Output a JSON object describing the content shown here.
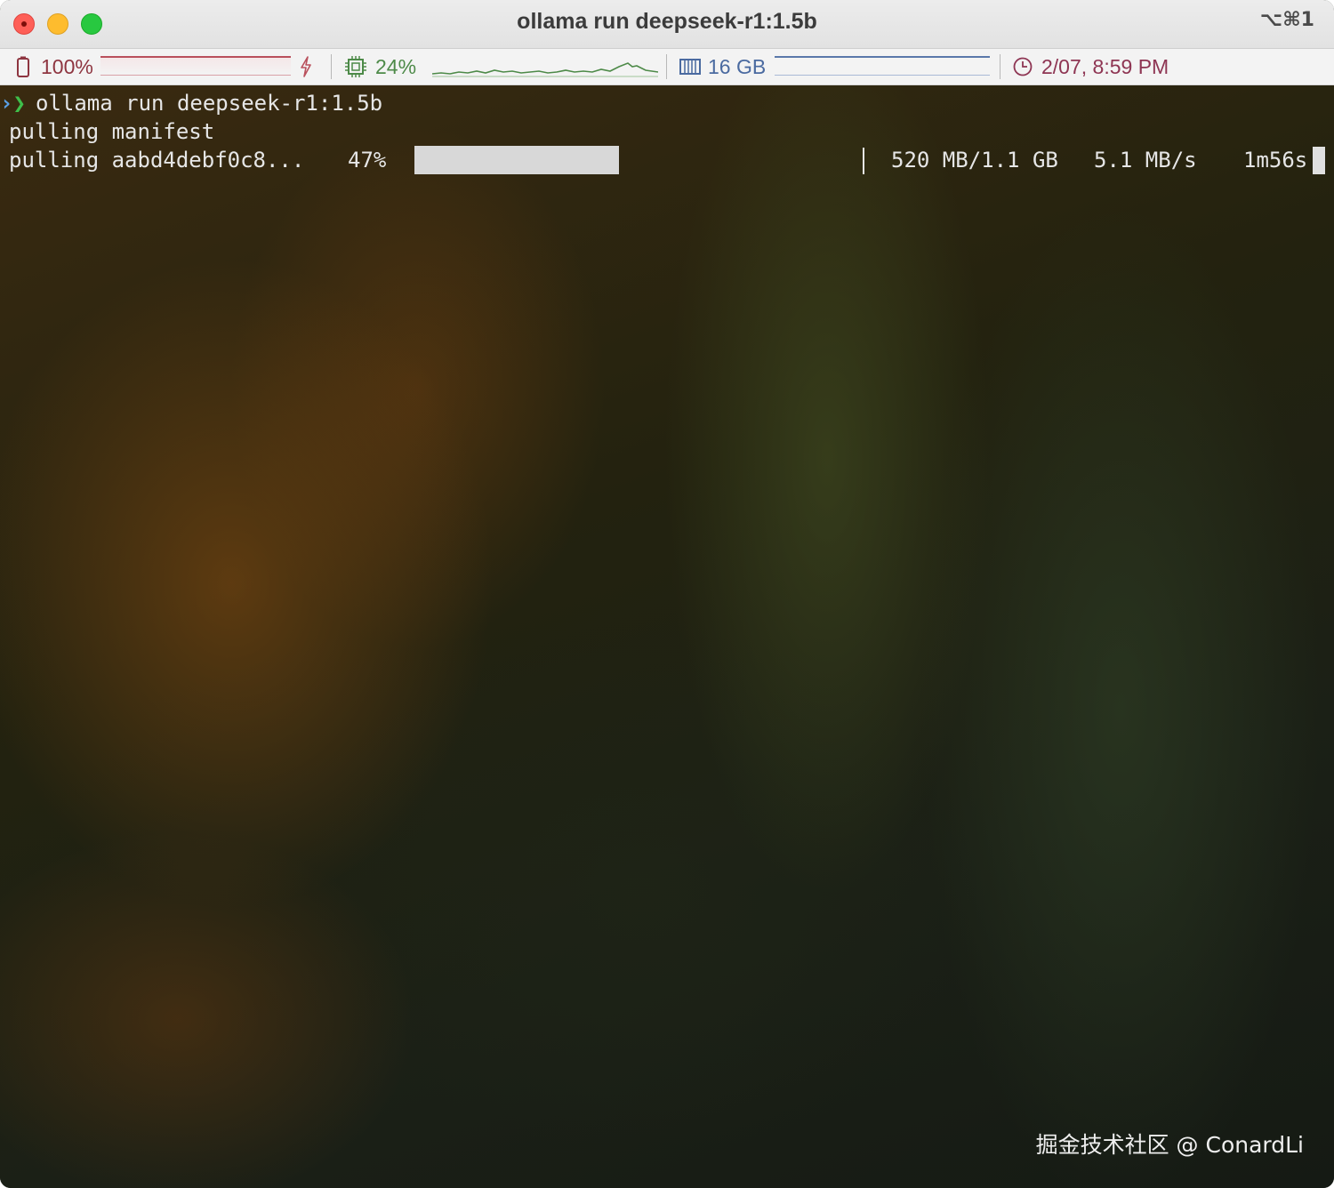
{
  "window": {
    "title": "ollama run deepseek-r1:1.5b",
    "shortcut": "⌥⌘1"
  },
  "status_bar": {
    "battery": {
      "icon": "battery-icon",
      "label": "100%",
      "level": 1.0,
      "charging_icon": "lightning-icon",
      "color": "#8e3540"
    },
    "cpu": {
      "icon": "cpu-chip-icon",
      "label": "24%",
      "color": "#4d8a48"
    },
    "memory": {
      "icon": "memory-icon",
      "label": "16 GB",
      "color": "#4a6aa0"
    },
    "clock": {
      "icon": "clock-icon",
      "label": "2/07, 8:59 PM",
      "color": "#8e3553"
    }
  },
  "terminal": {
    "prompt_symbol": "❯",
    "command": "ollama run deepseek-r1:1.5b",
    "lines": {
      "manifest": "pulling manifest",
      "pull_name": "pulling aabd4debf0c8...",
      "pull_percent": "47%",
      "pull_size": "520 MB/1.1 GB",
      "pull_speed": "5.1 MB/s",
      "pull_eta": "1m56s"
    },
    "progress": 0.47
  },
  "watermark": "掘金技术社区 @ ConardLi"
}
